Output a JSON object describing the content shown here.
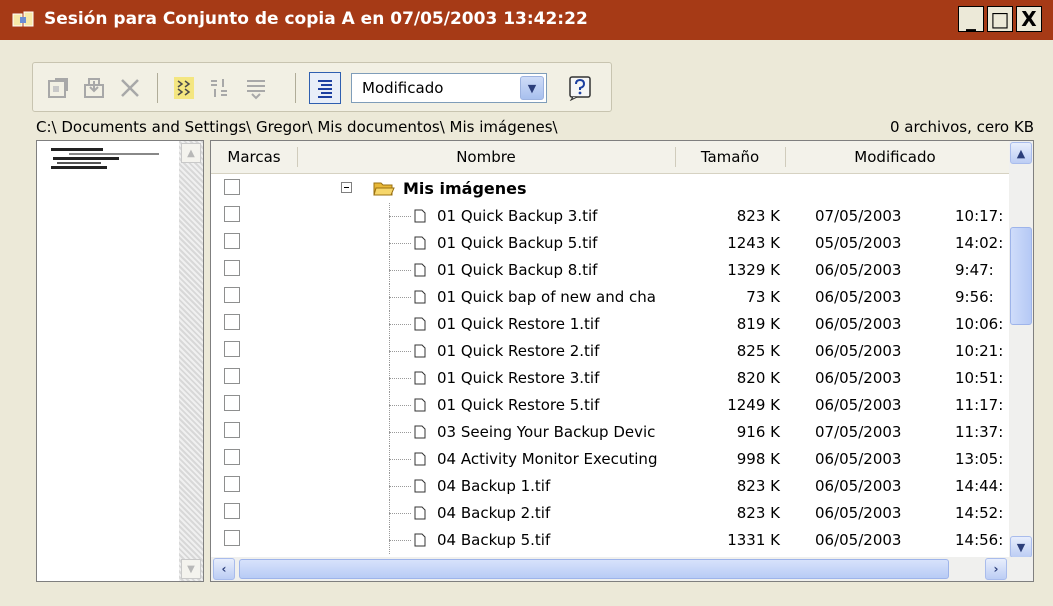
{
  "window": {
    "title": "Sesión para Conjunto de copia A en 07/05/2003 13:42:22",
    "minimize_glyph": "_",
    "maximize_glyph": "□",
    "close_glyph": "X"
  },
  "toolbar": {
    "buttons": [
      {
        "icon": "properties-icon",
        "enabled": false
      },
      {
        "icon": "restore-icon",
        "enabled": false
      },
      {
        "icon": "delete-icon",
        "enabled": false
      },
      {
        "icon": "mark-icon",
        "enabled": true
      },
      {
        "icon": "find-icon",
        "enabled": false
      },
      {
        "icon": "filter-icon",
        "enabled": false
      },
      {
        "icon": "sort-toggle-icon",
        "enabled": true,
        "pressed": true
      },
      {
        "icon": "help-icon",
        "enabled": true
      }
    ],
    "sort_select": {
      "value": "Modificado"
    }
  },
  "path_bar": {
    "path": "C:\\ Documents and Settings\\ Gregor\\ Mis documentos\\ Mis imágenes\\",
    "count": "0 archivos, cero KB"
  },
  "columns": {
    "marcas": "Marcas",
    "nombre": "Nombre",
    "tamano": "Tamaño",
    "modificado": "Modificado"
  },
  "folder": {
    "name": "Mis imágenes",
    "expander": "minus"
  },
  "files": [
    {
      "name": "01 Quick Backup 3.tif",
      "size": "823 K",
      "date": "07/05/2003",
      "time": "10:17:"
    },
    {
      "name": "01 Quick Backup 5.tif",
      "size": "1243 K",
      "date": "05/05/2003",
      "time": "14:02:"
    },
    {
      "name": "01 Quick Backup 8.tif",
      "size": "1329 K",
      "date": "06/05/2003",
      "time": "9:47:"
    },
    {
      "name": "01 Quick bap of new and cha",
      "size": "73 K",
      "date": "06/05/2003",
      "time": "9:56:"
    },
    {
      "name": "01 Quick Restore 1.tif",
      "size": "819 K",
      "date": "06/05/2003",
      "time": "10:06:"
    },
    {
      "name": "01 Quick Restore 2.tif",
      "size": "825 K",
      "date": "06/05/2003",
      "time": "10:21:"
    },
    {
      "name": "01 Quick Restore 3.tif",
      "size": "820 K",
      "date": "06/05/2003",
      "time": "10:51:"
    },
    {
      "name": "01 Quick Restore 5.tif",
      "size": "1249 K",
      "date": "06/05/2003",
      "time": "11:17:"
    },
    {
      "name": "03 Seeing Your Backup Devic",
      "size": "916 K",
      "date": "07/05/2003",
      "time": "11:37:"
    },
    {
      "name": "04 Activity Monitor Executing",
      "size": "998 K",
      "date": "06/05/2003",
      "time": "13:05:"
    },
    {
      "name": "04 Backup 1.tif",
      "size": "823 K",
      "date": "06/05/2003",
      "time": "14:44:"
    },
    {
      "name": "04 Backup 2.tif",
      "size": "823 K",
      "date": "06/05/2003",
      "time": "14:52:"
    },
    {
      "name": "04 Backup 5.tif",
      "size": "1331 K",
      "date": "06/05/2003",
      "time": "14:56:"
    }
  ],
  "colors": {
    "titlebar": "#a63a16",
    "window_bg": "#ece9d8",
    "scroll_blue": "#b8cbf5"
  }
}
